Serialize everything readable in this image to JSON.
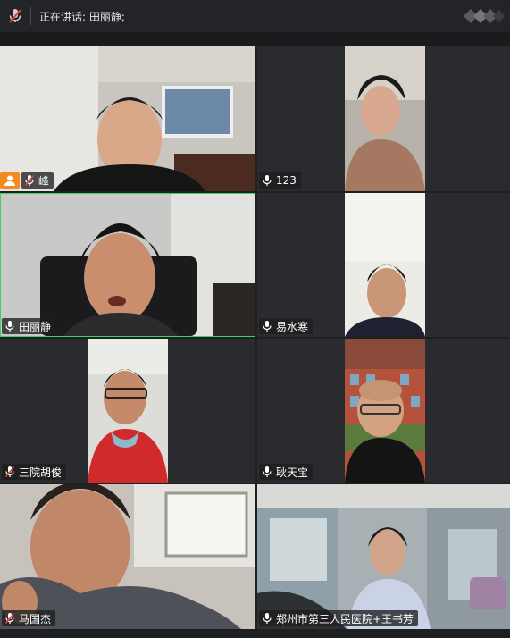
{
  "top_bar": {
    "speaking_label": "正在讲话: 田丽静;",
    "self_mic": "mic-muted-icon",
    "logo": "logo-icon"
  },
  "participants": [
    {
      "name": "峰",
      "mic": "muted",
      "host": true
    },
    {
      "name": "123",
      "mic": "on"
    },
    {
      "name": "田丽静",
      "mic": "on",
      "active_speaker": true
    },
    {
      "name": "易水寒",
      "mic": "on"
    },
    {
      "name": "三院胡俊",
      "mic": "muted"
    },
    {
      "name": "耿天宝",
      "mic": "on"
    },
    {
      "name": "马国杰",
      "mic": "muted"
    },
    {
      "name": "郑州市第三人民医院+王书芳",
      "mic": "on"
    }
  ],
  "colors": {
    "active_border": "#3fcf6c",
    "host_badge": "#f58a1f",
    "muted_slash": "#e0413a",
    "background": "#1e1f21",
    "tile": "#2a2b2e"
  }
}
